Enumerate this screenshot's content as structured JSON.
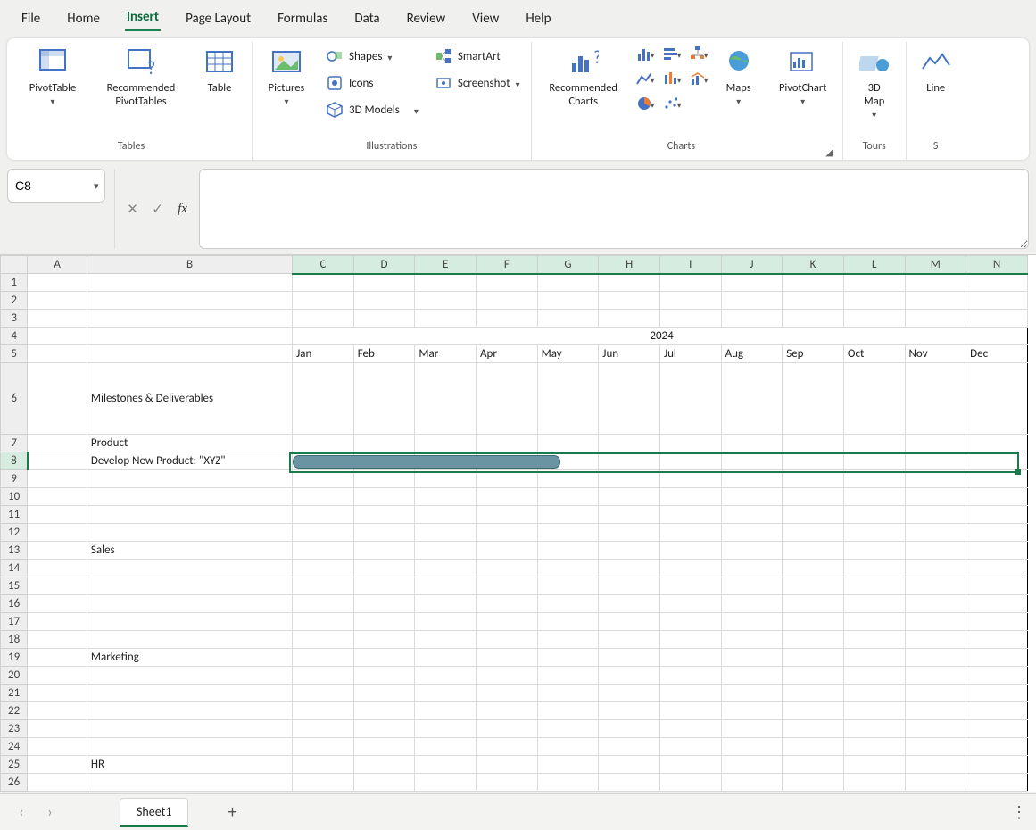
{
  "tabs": {
    "file": "File",
    "home": "Home",
    "insert": "Insert",
    "page_layout": "Page Layout",
    "formulas": "Formulas",
    "data": "Data",
    "review": "Review",
    "view": "View",
    "help": "Help",
    "active": "insert"
  },
  "ribbon": {
    "tables": {
      "label": "Tables",
      "pivot_table": "PivotTable",
      "recommended_pivot_tables_l1": "Recommended",
      "recommended_pivot_tables_l2": "PivotTables",
      "table": "Table"
    },
    "illustrations": {
      "label": "Illustrations",
      "pictures": "Pictures",
      "shapes": "Shapes",
      "icons": "Icons",
      "models": "3D Models",
      "smartart": "SmartArt",
      "screenshot": "Screenshot"
    },
    "charts": {
      "label": "Charts",
      "recommended_l1": "Recommended",
      "recommended_l2": "Charts",
      "maps": "Maps",
      "pivot_chart": "PivotChart"
    },
    "tours": {
      "label": "Tours",
      "map_l1": "3D",
      "map_l2": "Map"
    },
    "sparklines": {
      "label_partial": "S",
      "line": "Line"
    }
  },
  "formula_bar": {
    "name_box": "C8",
    "formula": ""
  },
  "grid": {
    "columns": [
      "A",
      "B",
      "C",
      "D",
      "E",
      "F",
      "G",
      "H",
      "I",
      "J",
      "K",
      "L",
      "M",
      "N"
    ],
    "row_numbers": [
      1,
      2,
      3,
      4,
      5,
      6,
      7,
      8,
      9,
      10,
      11,
      12,
      13,
      14,
      15,
      16,
      17,
      18,
      19,
      20,
      21,
      22,
      23,
      24,
      25,
      26
    ],
    "year_header": "2024",
    "months": [
      "Jan",
      "Feb",
      "Mar",
      "Apr",
      "May",
      "Jun",
      "Jul",
      "Aug",
      "Sep",
      "Oct",
      "Nov",
      "Dec"
    ],
    "rows": {
      "r6_b": "Milestones & Deliverables",
      "r7_b": "Product",
      "r8_b": "Develop New Product: \"XYZ\"",
      "r13_b": "Sales",
      "r19_b": "Marketing",
      "r25_b": "HR"
    },
    "selected_range": "C8:N8",
    "gantt": {
      "row": 8,
      "start_col": "C",
      "span_months": 4.5
    }
  },
  "sheet_tabs": {
    "active": "Sheet1"
  }
}
